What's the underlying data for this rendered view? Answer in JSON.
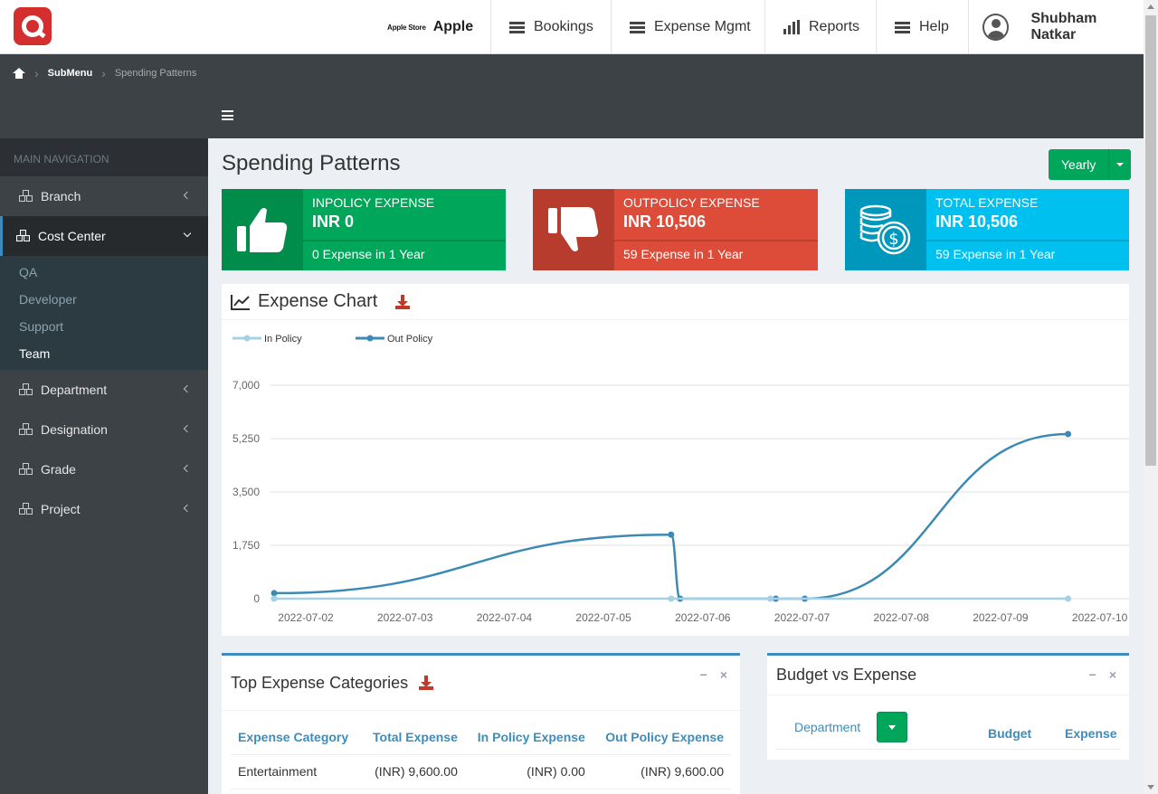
{
  "header": {
    "company_store": "Apple Store",
    "company_name": "Apple",
    "nav": [
      {
        "label": "Bookings",
        "icon": "list-icon"
      },
      {
        "label": "Expense Mgmt",
        "icon": "list-icon"
      },
      {
        "label": "Reports",
        "icon": "bar-chart-icon"
      },
      {
        "label": "Help",
        "icon": "list-icon"
      }
    ],
    "user_name": "Shubham Natkar"
  },
  "breadcrumb": {
    "items": [
      "SubMenu",
      "Spending Patterns"
    ]
  },
  "sidebar": {
    "header": "MAIN NAVIGATION",
    "items": [
      {
        "label": "Branch"
      },
      {
        "label": "Cost Center"
      },
      {
        "label": "Department"
      },
      {
        "label": "Designation"
      },
      {
        "label": "Grade"
      },
      {
        "label": "Project"
      }
    ],
    "submenu": [
      "QA",
      "Developer",
      "Support",
      "Team"
    ]
  },
  "page": {
    "title": "Spending Patterns",
    "period_button": "Yearly"
  },
  "infoboxes": [
    {
      "title": "INPOLICY EXPENSE",
      "amount": "INR 0",
      "desc": "0 Expense in 1 Year",
      "color": "#00a65a",
      "icon_color": "#008d4c",
      "icon": "thumbs-up-icon"
    },
    {
      "title": "OUTPOLICY EXPENSE",
      "amount": "INR 10,506",
      "desc": "59 Expense in 1 Year",
      "color": "#dd4b39",
      "icon_color": "#b83c2e",
      "icon": "thumbs-down-icon"
    },
    {
      "title": "TOTAL EXPENSE",
      "amount": "INR 10,506",
      "desc": "59 Expense in 1 Year",
      "color": "#00c0ef",
      "icon_color": "#0097bc",
      "icon": "coins-icon"
    }
  ],
  "chart_box": {
    "title": "Expense Chart"
  },
  "chart_data": {
    "type": "line",
    "x": [
      "2022-07-02",
      "2022-07-03",
      "2022-07-04",
      "2022-07-05",
      "2022-07-06",
      "2022-07-07",
      "2022-07-08",
      "2022-07-09",
      "2022-07-10"
    ],
    "ylim": [
      0,
      7000
    ],
    "yticks": [
      "7,000",
      "5,250",
      "3,500",
      "1,750",
      "0"
    ],
    "series": [
      {
        "name": "In Policy",
        "color": "#a6d0e4",
        "points": [
          [
            "2022-07-02",
            0
          ],
          [
            "2022-07-06",
            0
          ],
          [
            "2022-07-07",
            0
          ],
          [
            "2022-07-10",
            0
          ]
        ]
      },
      {
        "name": "Out Policy",
        "color": "#3c89b4",
        "points": [
          [
            "2022-07-02",
            180
          ],
          [
            "2022-07-06",
            2100
          ],
          [
            "2022-07-06",
            0
          ],
          [
            "2022-07-07",
            0
          ],
          [
            "2022-07-07",
            0
          ],
          [
            "2022-07-10",
            5400
          ]
        ]
      }
    ],
    "legend": "top-left",
    "grid": true
  },
  "table_box": {
    "title": "Top Expense Categories",
    "columns": [
      "Expense Category",
      "Total Expense",
      "In Policy Expense",
      "Out Policy Expense"
    ],
    "rows": [
      [
        "Entertainment",
        "(INR) 9,600.00",
        "(INR) 0.00",
        "(INR) 9,600.00"
      ]
    ]
  },
  "budget_box": {
    "title": "Budget vs Expense",
    "dept_label": "Department",
    "col_budget": "Budget",
    "col_expense": "Expense"
  },
  "box_tools": {
    "minimize": "−",
    "close": "×"
  }
}
